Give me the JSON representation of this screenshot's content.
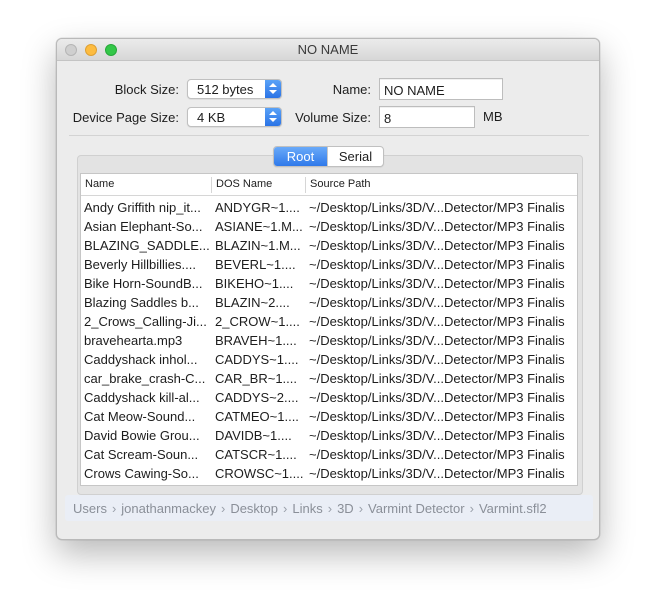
{
  "window": {
    "title": "NO NAME"
  },
  "form": {
    "block_size_label": "Block Size:",
    "block_size_value": "512 bytes",
    "device_page_size_label": "Device Page Size:",
    "device_page_size_value": "4 KB",
    "name_label": "Name:",
    "name_value": "NO NAME",
    "volume_size_label": "Volume Size:",
    "volume_size_value": "8",
    "volume_size_unit": "MB"
  },
  "tabs": {
    "root": "Root",
    "serial": "Serial",
    "selected": "Root"
  },
  "table": {
    "columns": [
      "Name",
      "DOS Name",
      "Source Path"
    ],
    "rows": [
      [
        "Andy Griffith nip_it...",
        "ANDYGR~1....",
        "~/Desktop/Links/3D/V...Detector/MP3 Finalis"
      ],
      [
        "Asian Elephant-So...",
        "ASIANE~1.M...",
        "~/Desktop/Links/3D/V...Detector/MP3 Finalis"
      ],
      [
        "BLAZING_SADDLE...",
        "BLAZIN~1.M...",
        "~/Desktop/Links/3D/V...Detector/MP3 Finalis"
      ],
      [
        "Beverly Hillbillies....",
        "BEVERL~1....",
        "~/Desktop/Links/3D/V...Detector/MP3 Finalis"
      ],
      [
        "Bike Horn-SoundB...",
        "BIKEHO~1....",
        "~/Desktop/Links/3D/V...Detector/MP3 Finalis"
      ],
      [
        "Blazing Saddles b...",
        "BLAZIN~2....",
        "~/Desktop/Links/3D/V...Detector/MP3 Finalis"
      ],
      [
        "2_Crows_Calling-Ji...",
        "2_CROW~1....",
        "~/Desktop/Links/3D/V...Detector/MP3 Finalis"
      ],
      [
        "bravehearta.mp3",
        "BRAVEH~1....",
        "~/Desktop/Links/3D/V...Detector/MP3 Finalis"
      ],
      [
        "Caddyshack inhol...",
        "CADDYS~1....",
        "~/Desktop/Links/3D/V...Detector/MP3 Finalis"
      ],
      [
        "car_brake_crash-C...",
        "CAR_BR~1....",
        "~/Desktop/Links/3D/V...Detector/MP3 Finalis"
      ],
      [
        "Caddyshack kill-al...",
        "CADDYS~2....",
        "~/Desktop/Links/3D/V...Detector/MP3 Finalis"
      ],
      [
        "Cat Meow-Sound...",
        "CATMEO~1....",
        "~/Desktop/Links/3D/V...Detector/MP3 Finalis"
      ],
      [
        "David Bowie Grou...",
        "DAVIDB~1....",
        "~/Desktop/Links/3D/V...Detector/MP3 Finalis"
      ],
      [
        "Cat Scream-Soun...",
        "CATSCR~1....",
        "~/Desktop/Links/3D/V...Detector/MP3 Finalis"
      ],
      [
        "Crows Cawing-So...",
        "CROWSC~1....",
        "~/Desktop/Links/3D/V...Detector/MP3 Finalis"
      ]
    ]
  },
  "pathbar": {
    "crumbs": [
      "Users",
      "jonathanmackey",
      "Desktop",
      "Links",
      "3D",
      "Varmint Detector",
      "Varmint.sfl2"
    ]
  }
}
